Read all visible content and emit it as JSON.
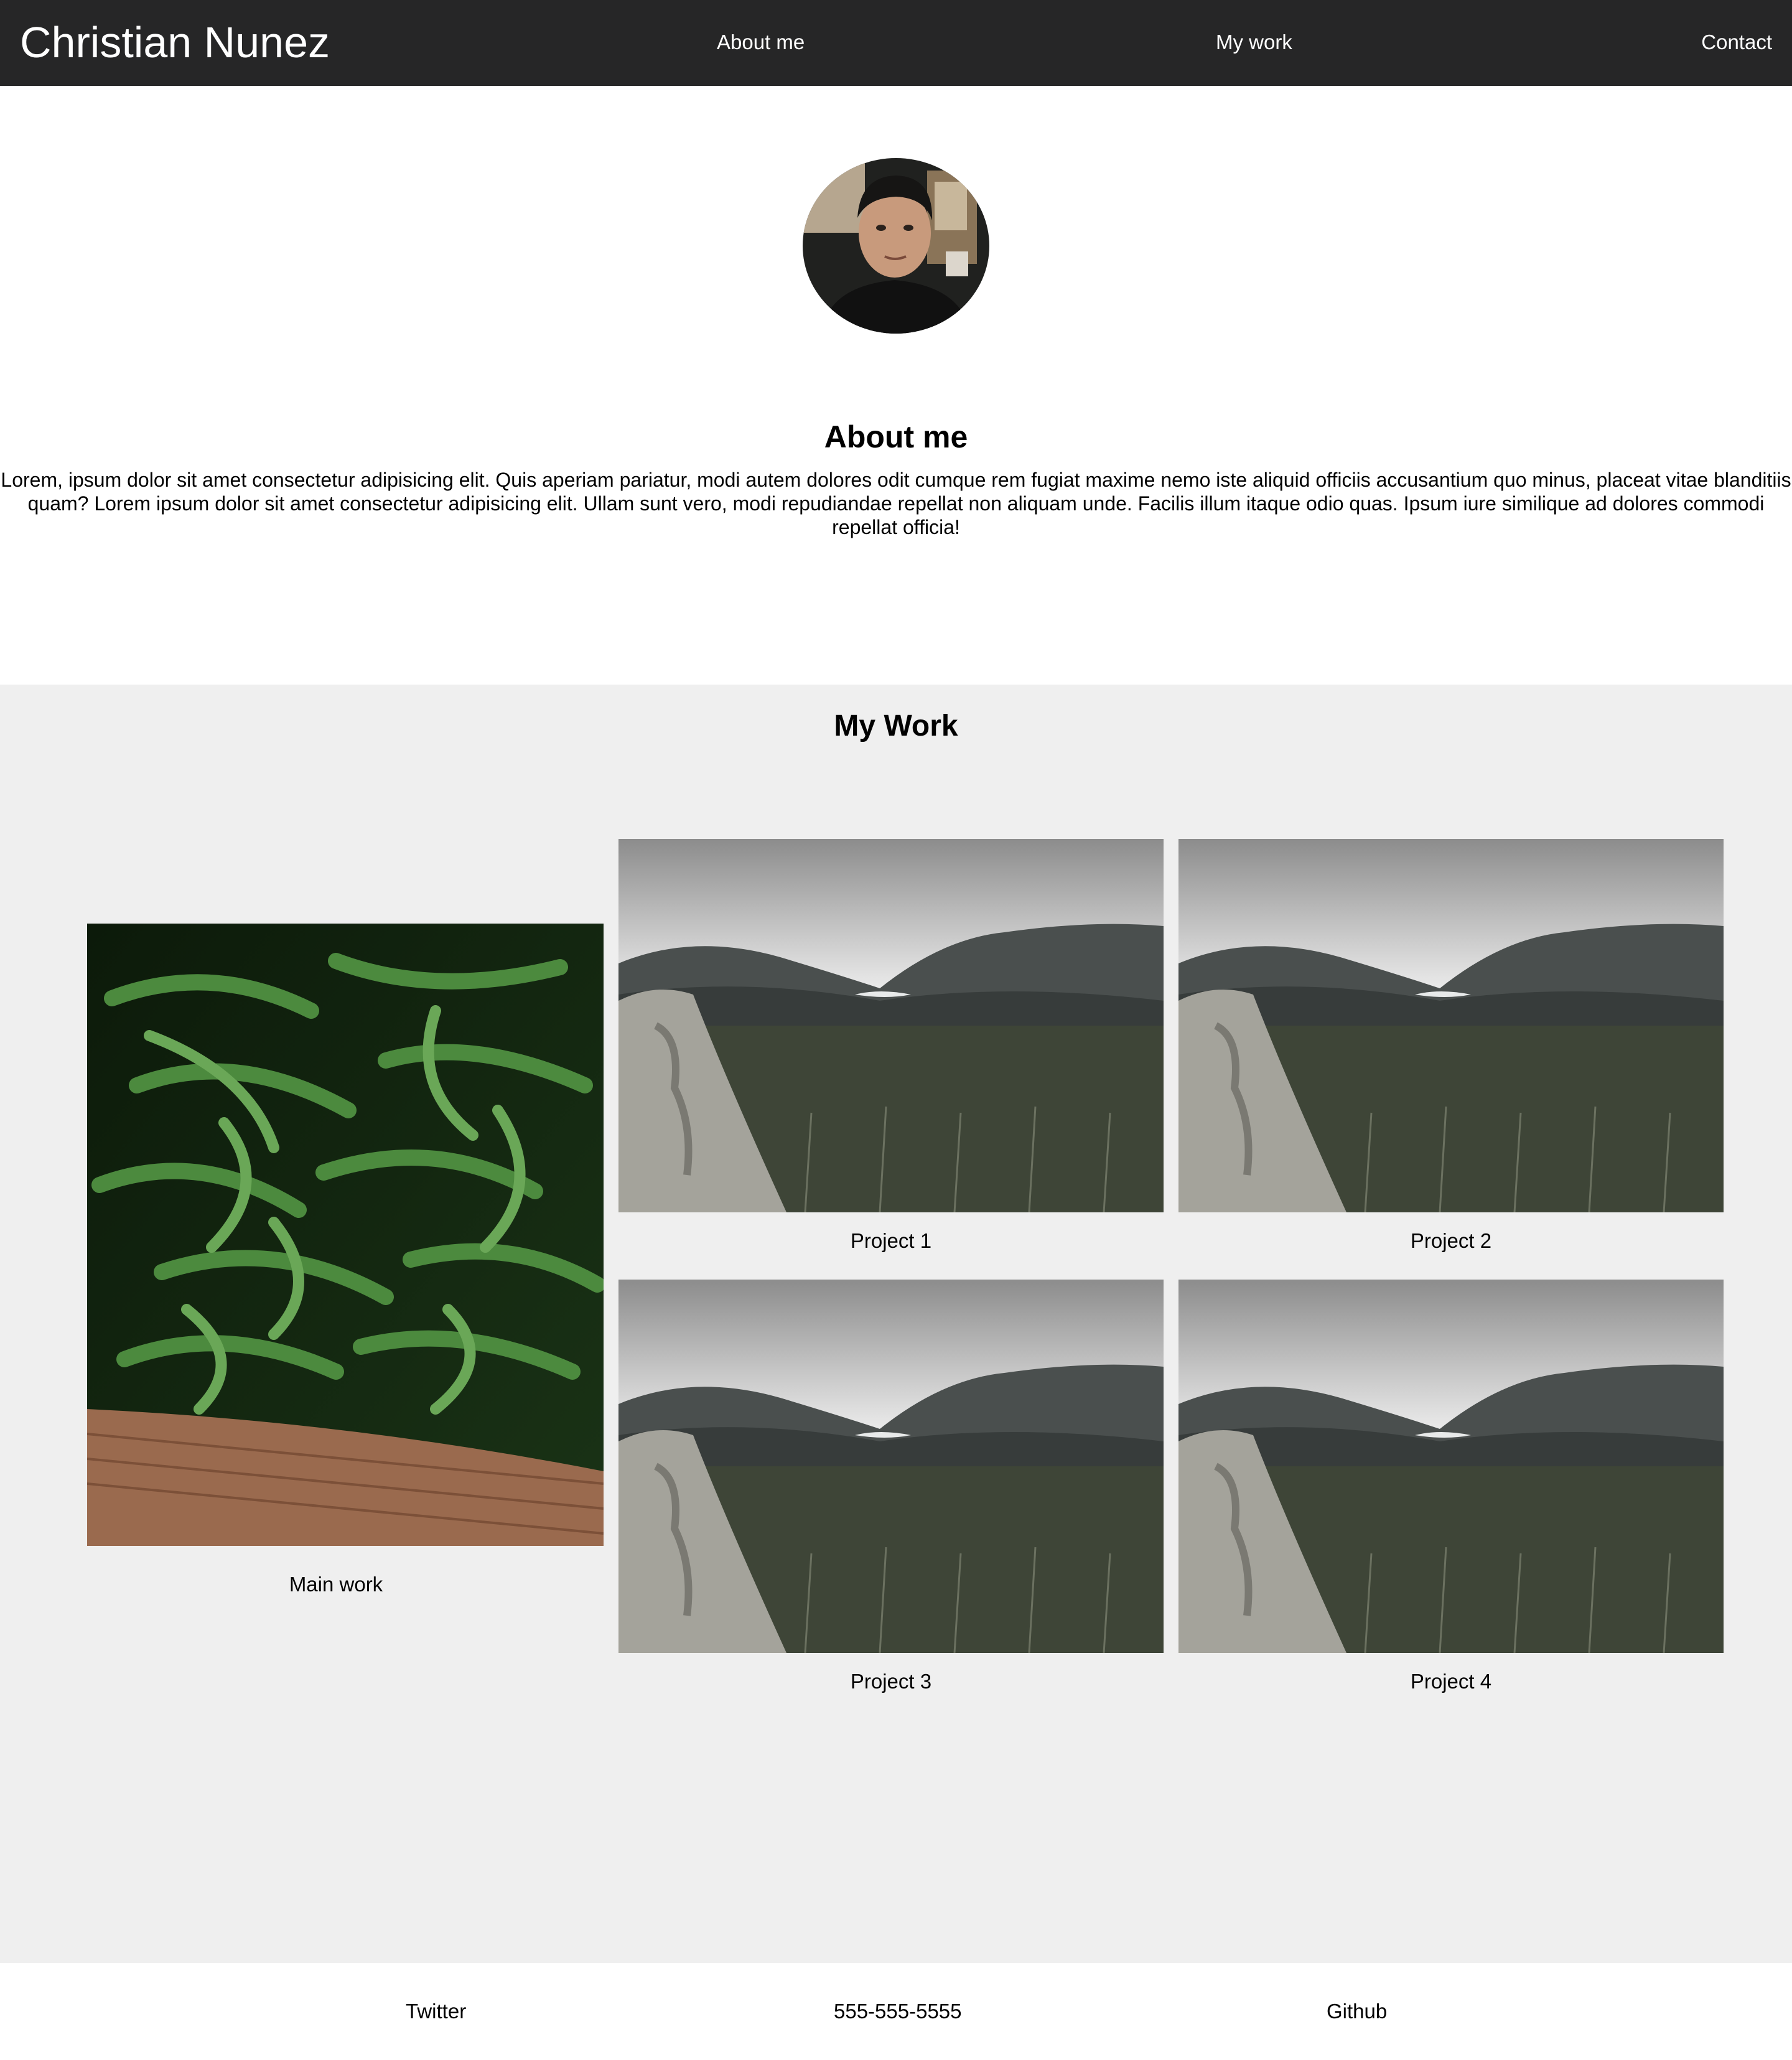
{
  "header": {
    "brand": "Christian Nunez",
    "nav": {
      "about": "About me",
      "work": "My work",
      "contact": "Contact"
    }
  },
  "about": {
    "title": "About me",
    "text": "Lorem, ipsum dolor sit amet consectetur adipisicing elit. Quis aperiam pariatur, modi autem dolores odit cumque rem fugiat maxime nemo iste aliquid officiis accusantium quo minus, placeat vitae blanditiis quam? Lorem ipsum dolor sit amet consectetur adipisicing elit. Ullam sunt vero, modi repudiandae repellat non aliquam unde. Facilis illum itaque odio quas. Ipsum iure similique ad dolores commodi repellat officia!"
  },
  "work": {
    "title": "My Work",
    "main_label": "Main work",
    "projects": [
      {
        "label": "Project 1"
      },
      {
        "label": "Project 2"
      },
      {
        "label": "Project 3"
      },
      {
        "label": "Project 4"
      }
    ]
  },
  "footer": {
    "twitter": "Twitter",
    "phone": "555-555-5555",
    "github": "Github"
  },
  "colors": {
    "header_bg": "#262627",
    "work_bg": "#efefef",
    "text": "#000000"
  },
  "images": {
    "avatar": "portrait-photo",
    "main_work": "green-beans-photo",
    "projects": "mountain-lake-landscape-photo"
  }
}
